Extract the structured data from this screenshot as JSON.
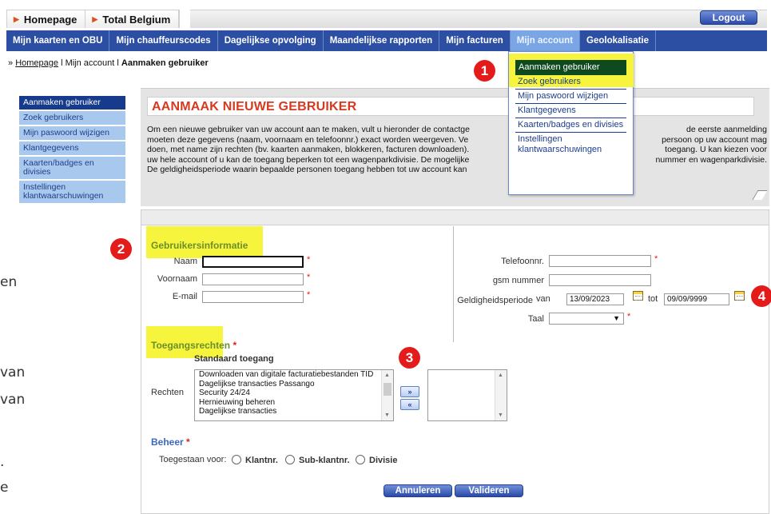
{
  "top": {
    "crumb1": "Homepage",
    "crumb2": "Total Belgium",
    "logout": "Logout"
  },
  "nav": [
    "Mijn kaarten en OBU",
    "Mijn chauffeurscodes",
    "Dagelijkse opvolging",
    "Maandelijkse rapporten",
    "Mijn facturen",
    "Mijn account",
    "Geolokalisatie"
  ],
  "breadcrumb": {
    "prefix": "» ",
    "home": "Homepage",
    "sep": " l ",
    "account": "Mijn account",
    "sep2": " l ",
    "current": "Aanmaken gebruiker"
  },
  "sidebar": [
    "Aanmaken gebruiker",
    "Zoek gebruikers",
    "Mijn paswoord wijzigen",
    "Klantgegevens",
    "Kaarten/badges en divisies",
    "Instellingen klantwaarschuwingen"
  ],
  "menu": [
    "Aanmaken gebruiker",
    "Zoek gebruikers",
    "Mijn paswoord wijzigen",
    "Klantgegevens",
    "Kaarten/badges en divisies",
    "Instellingen klantwaarschuwingen"
  ],
  "page": {
    "title": "AANMAAK NIEUWE GEBRUIKER",
    "desc": [
      "Om een nieuwe gebruiker van uw account aan te maken, vult u hieronder de contactge",
      "moeten deze gegevens (naam, voornaam en telefoonnr.) exact worden weergeven. Ve",
      "doen, met name zijn rechten (bv. kaarten aanmaken, blokkeren, facturen downloaden).",
      "uw hele account of u kan de toegang beperken tot een wagenparkdivisie. De mogelijke",
      "De geldigheidsperiode waarin bepaalde personen toegang hebben tot uw account kan"
    ],
    "desc_right": [
      "de eerste aanmelding",
      "persoon op uw account mag",
      "toegang. U kan kiezen voor",
      "nummer en wagenparkdivisie.",
      ""
    ]
  },
  "form": {
    "section_user": "Gebruikersinformatie",
    "naam": "Naam",
    "voornaam": "Voornaam",
    "email": "E-mail",
    "telefoon": "Telefoonnr.",
    "gsm": "gsm nummer",
    "geldig": "Geldigheidsperiode",
    "van": "van",
    "van_value": "13/09/2023",
    "tot": "tot",
    "tot_value": "09/09/9999",
    "taal": "Taal",
    "section_access": "Toegangsrechten",
    "standaard": "Standaard toegang",
    "rechten": "Rechten",
    "rights": [
      "Downloaden van digitale facturatiebestanden TID",
      "Dagelijkse transacties Passango",
      "Security 24/24",
      "Hernieuwing beheren",
      "Dagelijkse transacties"
    ],
    "move_right": "»",
    "move_left": "«",
    "beheer": "Beheer",
    "toegestaan": "Toegestaan voor:",
    "opt1": "Klantnr.",
    "opt2": "Sub-klantnr.",
    "opt3": "Divisie",
    "cancel": "Annuleren",
    "submit": "Valideren",
    "star": "*"
  },
  "badges": [
    "1",
    "2",
    "3",
    "4"
  ],
  "left_fragments": [
    "en",
    "van",
    "van",
    ".",
    "e"
  ]
}
